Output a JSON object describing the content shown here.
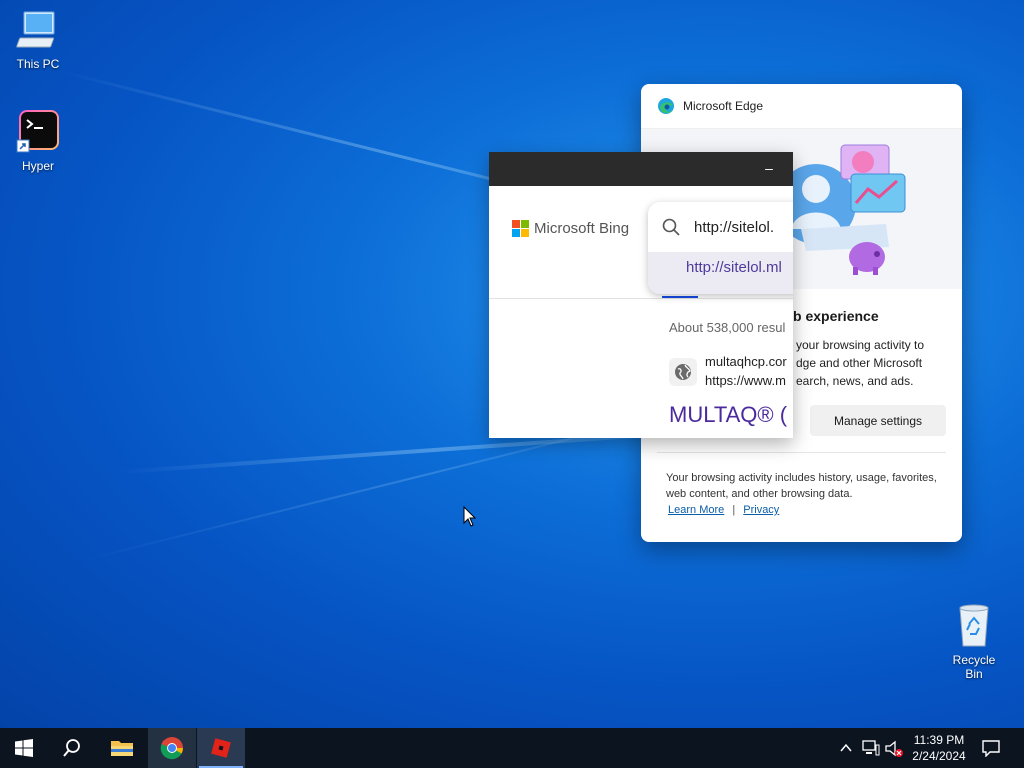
{
  "desktop": {
    "icons": [
      {
        "label": "This PC"
      },
      {
        "label": "Hyper"
      },
      {
        "label": "Recycle Bin"
      }
    ]
  },
  "edge_popup": {
    "title": "Microsoft Edge",
    "heading": "b experience",
    "body_lines": [
      "your browsing activity to",
      "dge and other Microsoft",
      "earch, news, and ads."
    ],
    "manage_button": "Manage settings",
    "footer_text": "Your browsing activity includes history, usage, favorites, web content, and other browsing data.",
    "learn_more": "Learn More",
    "separator": "|",
    "privacy": "Privacy"
  },
  "bing_window": {
    "minimize": "–",
    "logo_text": "Microsoft Bing",
    "search_value": "http://sitelol.",
    "suggestion": "http://sitelol.ml",
    "results_count": "About 538,000 resul",
    "result": {
      "site": "multaqhcp.cor",
      "url": "https://www.m",
      "title": "MULTAQ® ("
    }
  },
  "taskbar": {
    "time": "11:39 PM",
    "date": "2/24/2024"
  },
  "colors": {
    "bing_purple": "#4b2a9e",
    "taskbar": "#0c1420",
    "desktop_blue": "#0d6fd8"
  }
}
